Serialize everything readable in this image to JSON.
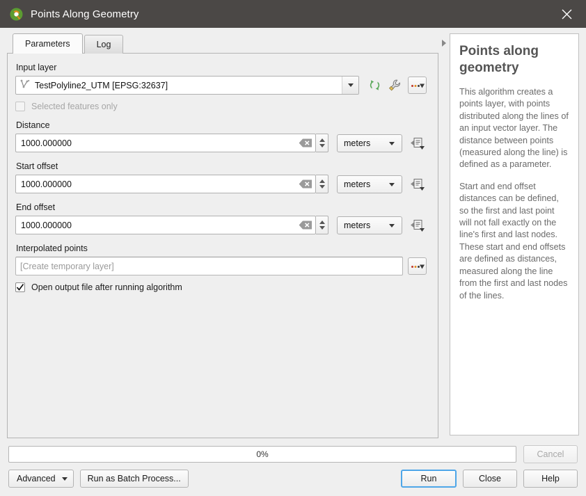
{
  "window": {
    "title": "Points Along Geometry",
    "logo_icon": "qgis-logo-icon",
    "close_icon": "close-icon"
  },
  "tabs": [
    {
      "label": "Parameters",
      "active": true
    },
    {
      "label": "Log",
      "active": false
    }
  ],
  "parameters": {
    "input_layer": {
      "label": "Input layer",
      "value": "TestPolyline2_UTM [EPSG:32637]",
      "layer_icon": "polyline-layer-icon",
      "dropdown_icon": "chevron-down-icon",
      "refresh_icon": "refresh-icon",
      "wrench_icon": "wrench-icon",
      "browse_icon": "ellipsis-dropdown-icon"
    },
    "selected_features_only": {
      "label": "Selected features only",
      "checked": false,
      "disabled": true
    },
    "distance": {
      "label": "Distance",
      "value": "1000.000000",
      "unit": "meters",
      "clear_icon": "clear-icon",
      "spinner_icon": "spinner-up-down-icon",
      "data_defined_icon": "data-defined-override-icon"
    },
    "start_offset": {
      "label": "Start offset",
      "value": "1000.000000",
      "unit": "meters",
      "clear_icon": "clear-icon",
      "spinner_icon": "spinner-up-down-icon",
      "data_defined_icon": "data-defined-override-icon"
    },
    "end_offset": {
      "label": "End offset",
      "value": "1000.000000",
      "unit": "meters",
      "clear_icon": "clear-icon",
      "spinner_icon": "spinner-up-down-icon",
      "data_defined_icon": "data-defined-override-icon"
    },
    "interpolated_points": {
      "label": "Interpolated points",
      "value": "",
      "placeholder": "[Create temporary layer]",
      "browse_icon": "ellipsis-dropdown-icon"
    },
    "open_output": {
      "label": "Open output file after running algorithm",
      "checked": true
    }
  },
  "splitter": {
    "icon": "collapse-panel-arrow-icon"
  },
  "help": {
    "title": "Points along geometry",
    "paragraphs": [
      "This algorithm creates a points layer, with points distributed along the lines of an input vector layer. The distance between points (measured along the line) is defined as a parameter.",
      "Start and end offset distances can be defined, so the first and last point will not fall exactly on the line's first and last nodes. These start and end offsets are defined as distances, measured along the line from the first and last nodes of the lines."
    ]
  },
  "footer": {
    "progress_text": "0%",
    "progress_percent": 0,
    "cancel_label": "Cancel",
    "cancel_disabled": true,
    "advanced_label": "Advanced",
    "advanced_icon": "chevron-down-icon",
    "batch_label": "Run as Batch Process...",
    "run_label": "Run",
    "close_label": "Close",
    "help_label": "Help"
  },
  "colors": {
    "titlebar": "#4b4846",
    "panel": "#efefef",
    "accent_default_button": "#4ea6e8",
    "help_text": "#6b6b6b",
    "help_title": "#555555",
    "refresh_green": "#5aa85a"
  }
}
